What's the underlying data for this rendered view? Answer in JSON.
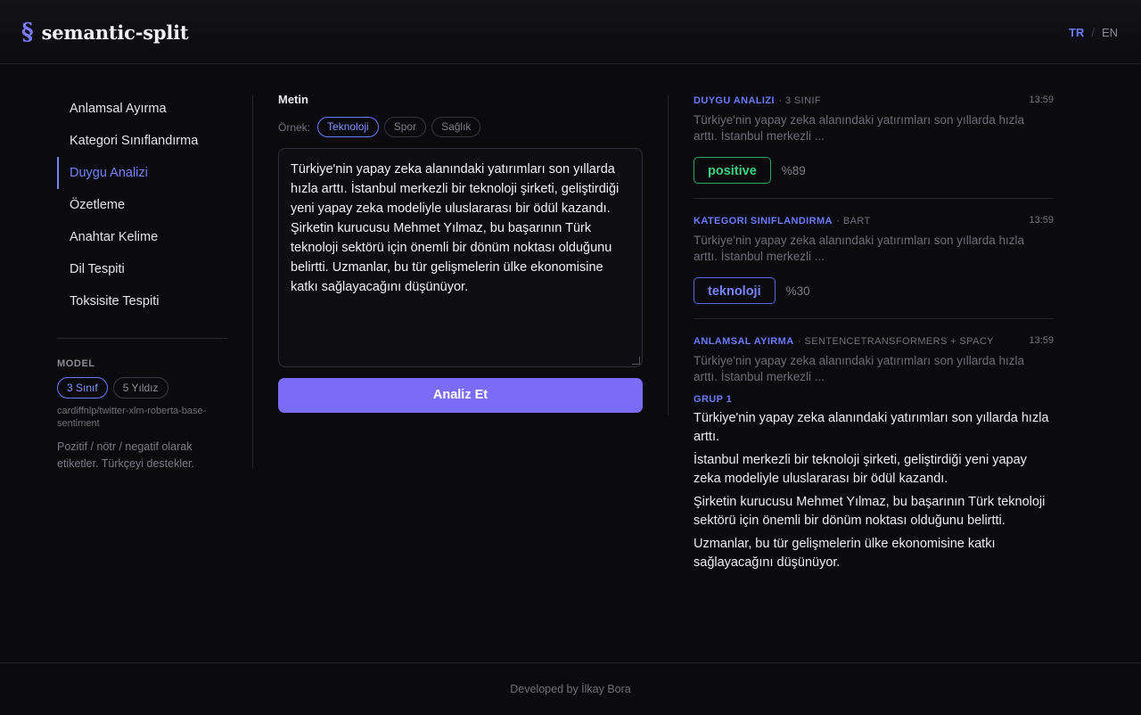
{
  "header": {
    "logo_mark": "§",
    "logo_text": "semantic-split",
    "lang_active": "TR",
    "lang_sep": "/",
    "lang_inactive": "EN"
  },
  "sidebar": {
    "items": [
      {
        "label": "Anlamsal Ayırma"
      },
      {
        "label": "Kategori Sınıflandırma"
      },
      {
        "label": "Duygu Analizi"
      },
      {
        "label": "Özetleme"
      },
      {
        "label": "Anahtar Kelime"
      },
      {
        "label": "Dil Tespiti"
      },
      {
        "label": "Toksisite Tespiti"
      }
    ],
    "active_index": 2,
    "model_label": "MODEL",
    "model_options": [
      "3 Sınıf",
      "5 Yıldız"
    ],
    "model_id": "cardiffnlp/twitter-xlm-roberta-base-sentiment",
    "model_desc": "Pozitif / nötr / negatif olarak etiketler. Türkçeyi destekler."
  },
  "center": {
    "label": "Metin",
    "examples_label": "Örnek:",
    "examples": [
      "Teknoloji",
      "Spor",
      "Sağlık"
    ],
    "text": "Türkiye'nin yapay zeka alanındaki yatırımları son yıllarda hızla arttı. İstanbul merkezli bir teknoloji şirketi, geliştirdiği yeni yapay zeka modeliyle uluslararası bir ödül kazandı. Şirketin kurucusu Mehmet Yılmaz, bu başarının Türk teknoloji sektörü için önemli bir dönüm noktası olduğunu belirtti. Uzmanlar, bu tür gelişmelerin ülke ekonomisine katkı sağlayacağını düşünüyor.",
    "button_label": "Analiz Et"
  },
  "results": {
    "r1": {
      "title": "DUYGU ANALIZI",
      "sub": "· 3 SINIF",
      "time": "13:59",
      "snippet": "Türkiye'nin yapay zeka alanındaki yatırımları son yıllarda hızla arttı. İstanbul merkezli ...",
      "label": "positive",
      "score": "%89"
    },
    "r2": {
      "title": "KATEGORI SINIFLANDIRMA",
      "sub": "· BART",
      "time": "13:59",
      "snippet": "Türkiye'nin yapay zeka alanındaki yatırımları son yıllarda hızla arttı. İstanbul merkezli ...",
      "label": "teknoloji",
      "score": "%30"
    },
    "r3": {
      "title": "ANLAMSAL AYIRMA",
      "sub": "· SENTENCETRANSFORMERS + SPACY",
      "time": "13:59",
      "snippet": "Türkiye'nin yapay zeka alanındaki yatırımları son yıllarda hızla arttı. İstanbul merkezli ...",
      "group_label": "GRUP 1",
      "sentences": [
        "Türkiye'nin yapay zeka alanındaki yatırımları son yıllarda hızla arttı.",
        "İstanbul merkezli bir teknoloji şirketi, geliştirdiği yeni yapay zeka modeliyle uluslararası bir ödül kazandı.",
        "Şirketin kurucusu Mehmet Yılmaz, bu başarının Türk teknoloji sektörü için önemli bir dönüm noktası olduğunu belirtti.",
        "Uzmanlar, bu tür gelişmelerin ülke ekonomisine katkı sağlayacağını düşünüyor."
      ]
    }
  },
  "footer": {
    "text": "Developed by İlkay Bora"
  },
  "colors": {
    "accent": "#6b79ff",
    "button": "#7a6cf5",
    "positive": "#3fcf83"
  }
}
